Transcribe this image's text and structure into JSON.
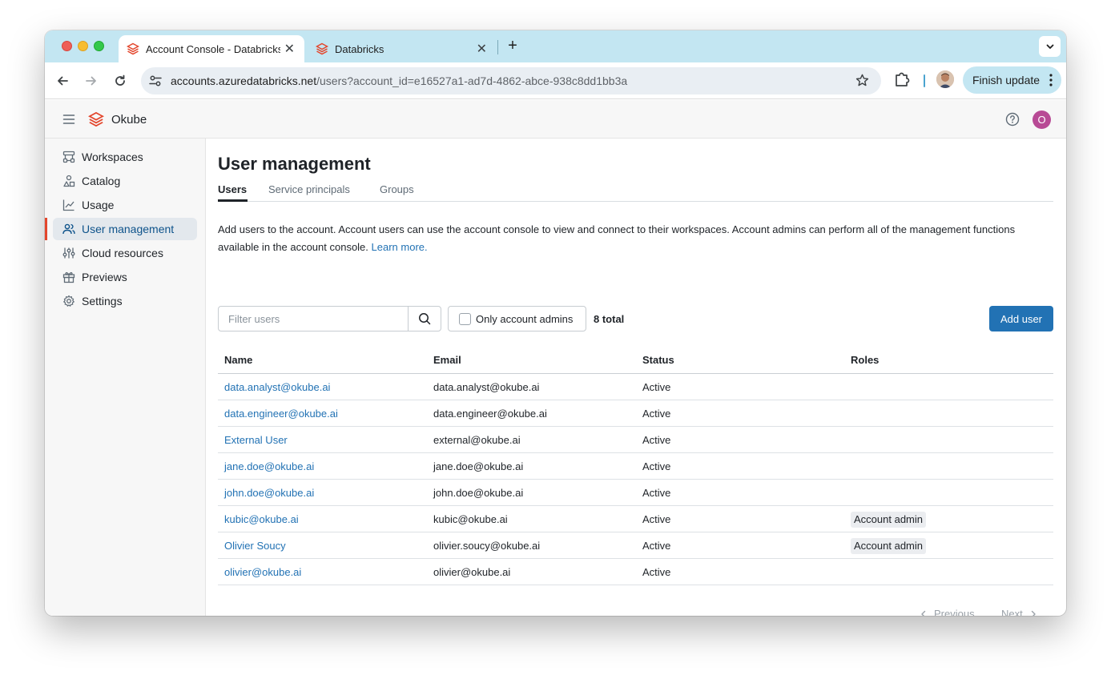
{
  "browser": {
    "tabs": [
      {
        "title": "Account Console - Databricks",
        "active": true
      },
      {
        "title": "Databricks",
        "active": false
      }
    ],
    "url_host": "accounts.azuredatabricks.net",
    "url_rest": "/users?account_id=e16527a1-ad7d-4862-abce-938c8dd1bb3a",
    "finish_update_label": "Finish update"
  },
  "header": {
    "workspace_name": "Okube",
    "avatar_initial": "O"
  },
  "sidebar": {
    "items": [
      {
        "label": "Workspaces",
        "icon": "workspaces-icon"
      },
      {
        "label": "Catalog",
        "icon": "catalog-icon"
      },
      {
        "label": "Usage",
        "icon": "usage-chart-icon"
      },
      {
        "label": "User management",
        "icon": "users-icon",
        "selected": true
      },
      {
        "label": "Cloud resources",
        "icon": "sliders-icon"
      },
      {
        "label": "Previews",
        "icon": "gift-icon"
      },
      {
        "label": "Settings",
        "icon": "gear-icon"
      }
    ]
  },
  "main": {
    "title": "User management",
    "tabs": [
      "Users",
      "Service principals",
      "Groups"
    ],
    "description": "Add users to the account. Account users can use the account console to view and connect to their workspaces. Account admins can perform all of the management functions available in the account console.",
    "learn_more": "Learn more.",
    "filter_placeholder": "Filter users",
    "only_admins_label": "Only account admins",
    "total_label": "8 total",
    "add_user_label": "Add user",
    "table": {
      "headers": [
        "Name",
        "Email",
        "Status",
        "Roles"
      ],
      "rows": [
        {
          "name": "data.analyst@okube.ai",
          "email": "data.analyst@okube.ai",
          "status": "Active",
          "role": ""
        },
        {
          "name": "data.engineer@okube.ai",
          "email": "data.engineer@okube.ai",
          "status": "Active",
          "role": ""
        },
        {
          "name": "External User",
          "email": "external@okube.ai",
          "status": "Active",
          "role": ""
        },
        {
          "name": "jane.doe@okube.ai",
          "email": "jane.doe@okube.ai",
          "status": "Active",
          "role": ""
        },
        {
          "name": "john.doe@okube.ai",
          "email": "john.doe@okube.ai",
          "status": "Active",
          "role": ""
        },
        {
          "name": "kubic@okube.ai",
          "email": "kubic@okube.ai",
          "status": "Active",
          "role": "Account admin"
        },
        {
          "name": "Olivier Soucy",
          "email": "olivier.soucy@okube.ai",
          "status": "Active",
          "role": "Account admin"
        },
        {
          "name": "olivier@okube.ai",
          "email": "olivier@okube.ai",
          "status": "Active",
          "role": ""
        }
      ]
    },
    "pagination": {
      "previous": "Previous",
      "next": "Next"
    }
  },
  "colors": {
    "accent": "#2272b4",
    "brand": "#e3462c",
    "tabstrip": "#c3e6f2",
    "avatar": "#b84a95"
  }
}
